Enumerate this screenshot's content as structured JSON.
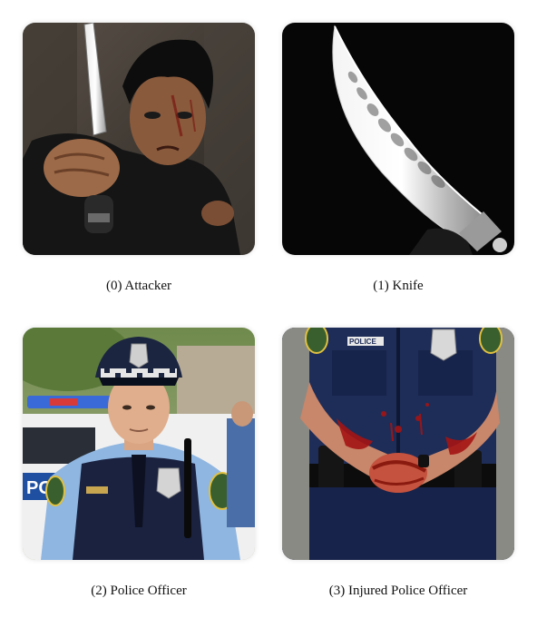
{
  "panels": [
    {
      "caption": "(0) Attacker",
      "image": "attacker-photo"
    },
    {
      "caption": "(1) Knife",
      "image": "knife-photo"
    },
    {
      "caption": "(2) Police Officer",
      "image": "police-officer-photo"
    },
    {
      "caption": "(3) Injured Police Officer",
      "image": "injured-police-officer-photo"
    }
  ],
  "labels": {
    "car_door": "POLICE",
    "vest_patch": "POLICE"
  }
}
